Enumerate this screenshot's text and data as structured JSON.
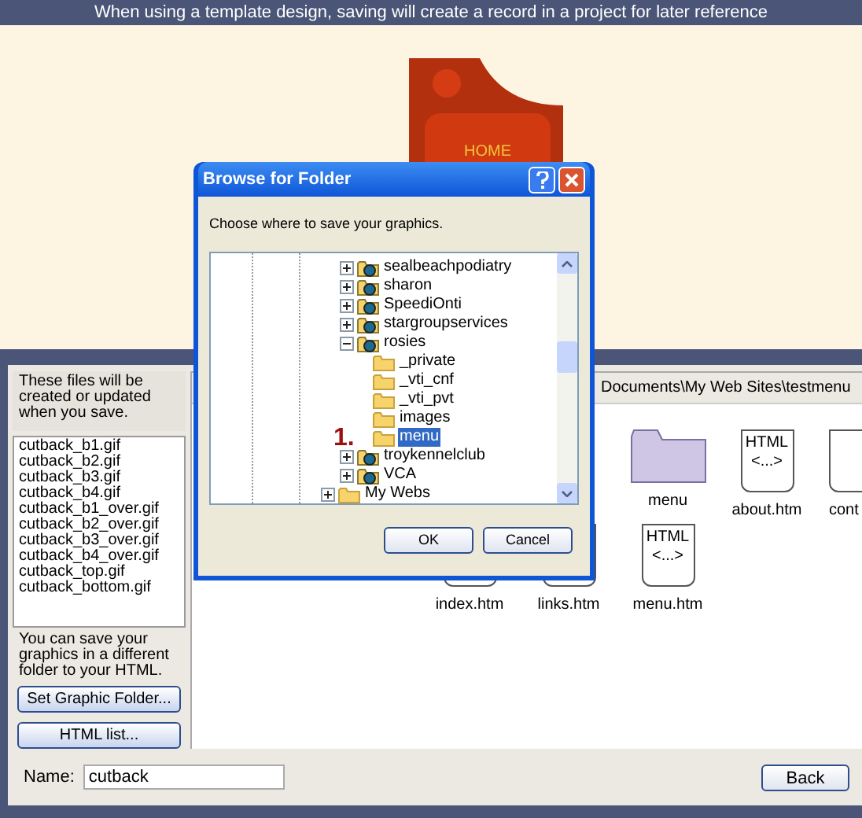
{
  "banner": {
    "text": "When using a template design, saving will create a record in a project for later reference"
  },
  "logo": {
    "label": "HOME"
  },
  "dialog": {
    "title": "Browse for Folder",
    "prompt": "Choose where to save your graphics.",
    "tree": [
      {
        "label": "sealbeachpodiatry",
        "kind": "web",
        "expanded": false,
        "selected": false
      },
      {
        "label": "sharon",
        "kind": "web",
        "expanded": false,
        "selected": false
      },
      {
        "label": "SpeediOnti",
        "kind": "web",
        "expanded": false,
        "selected": false
      },
      {
        "label": "stargroupservices",
        "kind": "web",
        "expanded": false,
        "selected": false
      },
      {
        "label": "rosies",
        "kind": "web",
        "expanded": true,
        "selected": false,
        "children": [
          {
            "label": "_private",
            "kind": "folder",
            "selected": false
          },
          {
            "label": "_vti_cnf",
            "kind": "folder",
            "selected": false
          },
          {
            "label": "_vti_pvt",
            "kind": "folder",
            "selected": false
          },
          {
            "label": "images",
            "kind": "folder",
            "selected": false
          },
          {
            "label": "menu",
            "kind": "folder",
            "selected": true
          }
        ]
      },
      {
        "label": "troykennelclub",
        "kind": "web",
        "expanded": false,
        "selected": false
      },
      {
        "label": "VCA",
        "kind": "web",
        "expanded": false,
        "selected": false
      }
    ],
    "outer_items": [
      {
        "label": "My Webs",
        "kind": "folder",
        "expanded": false,
        "selected": false
      }
    ],
    "annotation": "1.",
    "buttons": [
      "OK",
      "Cancel"
    ]
  },
  "files_panel": {
    "intro": "These files will be created or updated when you save.",
    "files": [
      "cutback_b1.gif",
      "cutback_b2.gif",
      "cutback_b3.gif",
      "cutback_b4.gif",
      "cutback_b1_over.gif",
      "cutback_b2_over.gif",
      "cutback_b3_over.gif",
      "cutback_b4_over.gif",
      "cutback_top.gif",
      "cutback_bottom.gif"
    ],
    "note": "You can save your graphics in a different folder to your HTML.",
    "buttons": [
      "Set Graphic Folder...",
      "HTML list..."
    ]
  },
  "browser": {
    "path": "Documents\\My Web Sites\\testmenu",
    "items": [
      {
        "name": "menu",
        "kind": "folder"
      },
      {
        "name": "about.htm",
        "kind": "html",
        "icon_lines": [
          "HTML",
          "<...>"
        ]
      },
      {
        "name": "cont",
        "kind": "html"
      },
      {
        "name": "index.htm",
        "kind": "html"
      },
      {
        "name": "links.htm",
        "kind": "html"
      },
      {
        "name": "menu.htm",
        "kind": "html",
        "icon_lines": [
          "HTML",
          "<...>"
        ]
      }
    ]
  },
  "name_field": {
    "label": "Name:",
    "value": "cutback"
  },
  "back_button": "Back"
}
